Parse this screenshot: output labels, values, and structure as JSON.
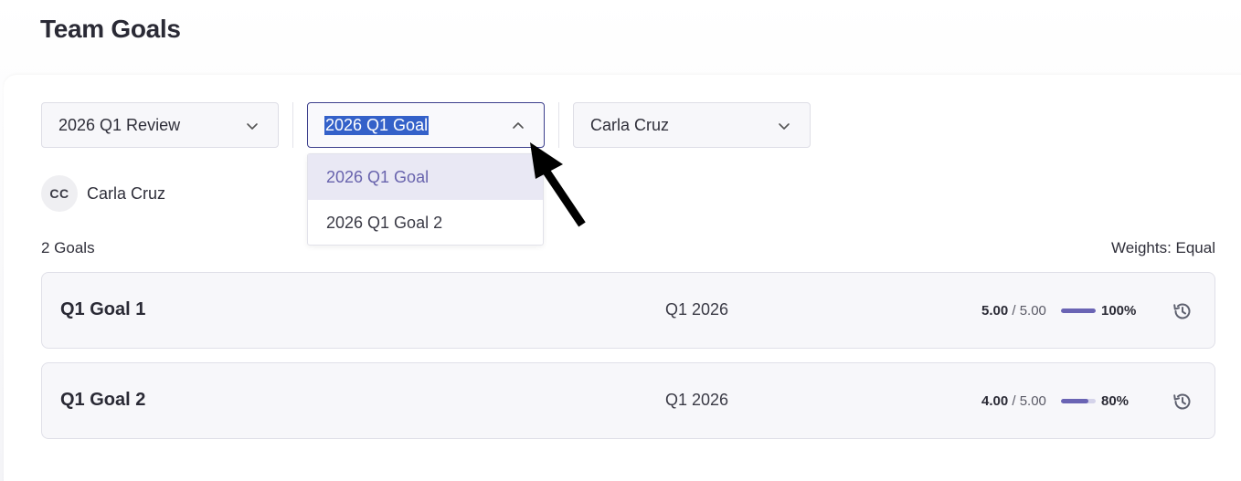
{
  "page": {
    "title": "Team Goals"
  },
  "filters": {
    "review_select": {
      "value": "2026 Q1 Review"
    },
    "goal_select": {
      "value": "2026 Q1 Goal",
      "options": [
        "2026 Q1 Goal",
        "2026 Q1 Goal 2"
      ]
    },
    "person_select": {
      "value": "Carla Cruz"
    }
  },
  "user": {
    "initials": "CC",
    "name": "Carla Cruz"
  },
  "summary": {
    "count_label": "2 Goals",
    "weights_label": "Weights: Equal"
  },
  "goals": [
    {
      "title": "Q1 Goal 1",
      "period": "Q1 2026",
      "score": "5.00",
      "max": "/ 5.00",
      "percent_label": "100%",
      "progress": 1.0
    },
    {
      "title": "Q1 Goal 2",
      "period": "Q1 2026",
      "score": "4.00",
      "max": "/ 5.00",
      "percent_label": "80%",
      "progress": 0.8
    }
  ],
  "colors": {
    "accent": "#6a64b4",
    "selection": "#3461c9",
    "active_option_bg": "#e9e8f4"
  },
  "icons": {
    "chevron_down": "chevron-down-icon",
    "chevron_up": "chevron-up-icon",
    "history": "history-icon",
    "cursor": "mouse-pointer-icon"
  }
}
